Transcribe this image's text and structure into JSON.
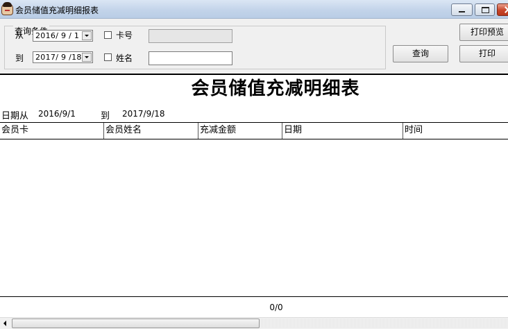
{
  "window": {
    "title": "会员储值充减明细报表"
  },
  "query": {
    "group_title": "查询条件",
    "from_label": "从",
    "to_label": "到",
    "from_date": "2016/ 9 / 1",
    "to_date": "2017/ 9 /18",
    "card_label": "卡号",
    "name_label": "姓名",
    "card_value": "",
    "name_value": "",
    "search_button": "查询",
    "print_preview_button": "打印预览",
    "print_button": "打印"
  },
  "report": {
    "title": "会员储值充减明细表",
    "range_prefix": "日期从",
    "range_from": "2016/9/1",
    "range_to_label": "到",
    "range_to": "2017/9/18",
    "columns": [
      "会员卡",
      "会员姓名",
      "充减金额",
      "日期",
      "时间"
    ],
    "rows": [],
    "page_indicator": "0/0"
  }
}
